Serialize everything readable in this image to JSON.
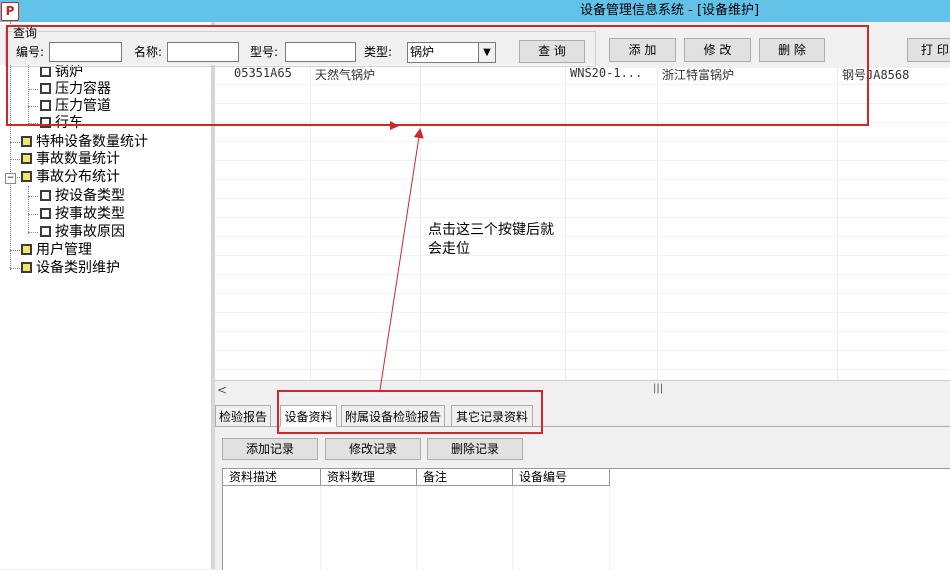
{
  "window": {
    "title": "设备管理信息系统 - [设备维护]",
    "icon": "app-icon"
  },
  "query": {
    "legend": "查询",
    "code_label": "编号:",
    "name_label": "名称:",
    "model_label": "型号:",
    "type_label": "类型:",
    "type_value": "锅炉",
    "search_button": "查 询"
  },
  "toolbar": {
    "add": "添 加",
    "edit": "修 改",
    "delete": "删 除",
    "print": "打 印"
  },
  "tree": {
    "items": [
      {
        "label": "锅炉",
        "icon": "doc-icon"
      },
      {
        "label": "压力容器",
        "icon": "doc-icon"
      },
      {
        "label": "压力管道",
        "icon": "doc-icon"
      },
      {
        "label": "行车",
        "icon": "doc-icon"
      },
      {
        "label": "特种设备数量统计",
        "icon": "folder-icon"
      },
      {
        "label": "事故数量统计",
        "icon": "folder-icon"
      },
      {
        "label": "事故分布统计",
        "icon": "folder-icon"
      },
      {
        "label": "按设备类型",
        "icon": "doc-icon"
      },
      {
        "label": "按事故类型",
        "icon": "doc-icon"
      },
      {
        "label": "按事故原因",
        "icon": "doc-icon"
      },
      {
        "label": "用户管理",
        "icon": "folder-icon"
      },
      {
        "label": "设备类别维护",
        "icon": "folder-icon"
      }
    ]
  },
  "grid": {
    "rows": [
      [
        "05351A65",
        "天然气锅炉",
        "WNS20-1...",
        "浙江特富锅炉",
        "钢号JA8568"
      ]
    ]
  },
  "tabs": [
    "检验报告",
    "设备资料",
    "附属设备检验报告",
    "其它记录资料"
  ],
  "record_buttons": {
    "add": "添加记录",
    "edit": "修改记录",
    "delete": "删除记录"
  },
  "subgrid": {
    "columns": [
      "资料描述",
      "资料数理",
      "备注",
      "设备编号"
    ]
  },
  "annotation": {
    "text": "点击这三个按键后就\n会走位"
  },
  "colors": {
    "titlebar": "#62c2e8",
    "annotation_red": "#d4262a"
  }
}
